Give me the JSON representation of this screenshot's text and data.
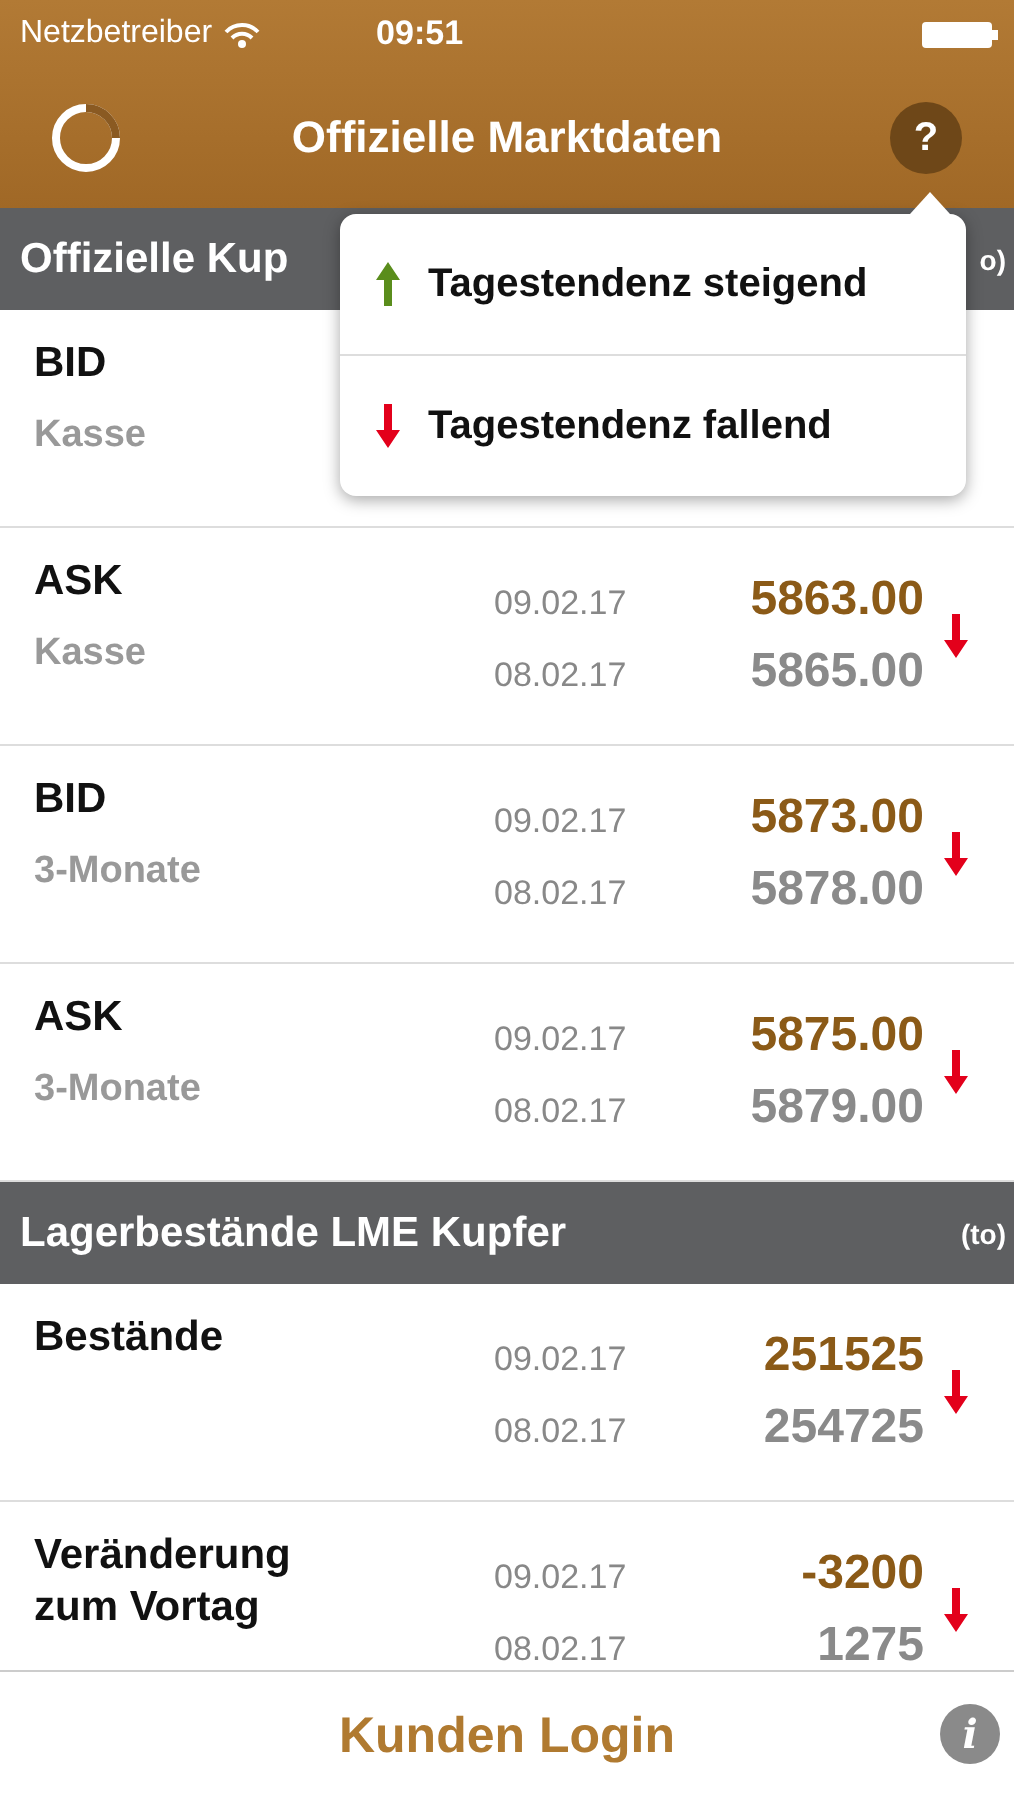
{
  "status_bar": {
    "carrier": "Netzbetreiber",
    "time": "09:51"
  },
  "nav": {
    "title": "Offizielle Marktdaten",
    "help": "?"
  },
  "sections": [
    {
      "title": "Offizielle Kup",
      "unit": "o)",
      "rows": [
        {
          "label": "BID",
          "sub": "Kasse",
          "entries": []
        },
        {
          "label": "ASK",
          "sub": "Kasse",
          "entries": [
            {
              "date": "09.02.17",
              "value": "5863.00"
            },
            {
              "date": "08.02.17",
              "value": "5865.00"
            }
          ],
          "kind": "falling"
        },
        {
          "label": "BID",
          "sub": "3-Monate",
          "entries": [
            {
              "date": "09.02.17",
              "value": "5873.00"
            },
            {
              "date": "08.02.17",
              "value": "5878.00"
            }
          ],
          "kind": "falling"
        },
        {
          "label": "ASK",
          "sub": "3-Monate",
          "entries": [
            {
              "date": "09.02.17",
              "value": "5875.00"
            },
            {
              "date": "08.02.17",
              "value": "5879.00"
            }
          ],
          "kind": "falling"
        }
      ]
    },
    {
      "title": "Lagerbestände LME Kupfer",
      "unit": "(to)",
      "rows": [
        {
          "label": "Bestände",
          "entries": [
            {
              "date": "09.02.17",
              "value": "251525"
            },
            {
              "date": "08.02.17",
              "value": "254725"
            }
          ],
          "kind": "falling"
        },
        {
          "label": "Veränderung zum Vortag",
          "entries": [
            {
              "date": "09.02.17",
              "value": "-3200"
            },
            {
              "date": "08.02.17",
              "value": "1275"
            }
          ],
          "kind": "falling"
        }
      ]
    }
  ],
  "popover": {
    "items": [
      {
        "label": "Tagestendenz steigend",
        "kind": "rising"
      },
      {
        "label": "Tagestendenz fallend",
        "kind": "falling"
      }
    ]
  },
  "bottom_bar": {
    "login": "Kunden Login",
    "info": "i"
  }
}
